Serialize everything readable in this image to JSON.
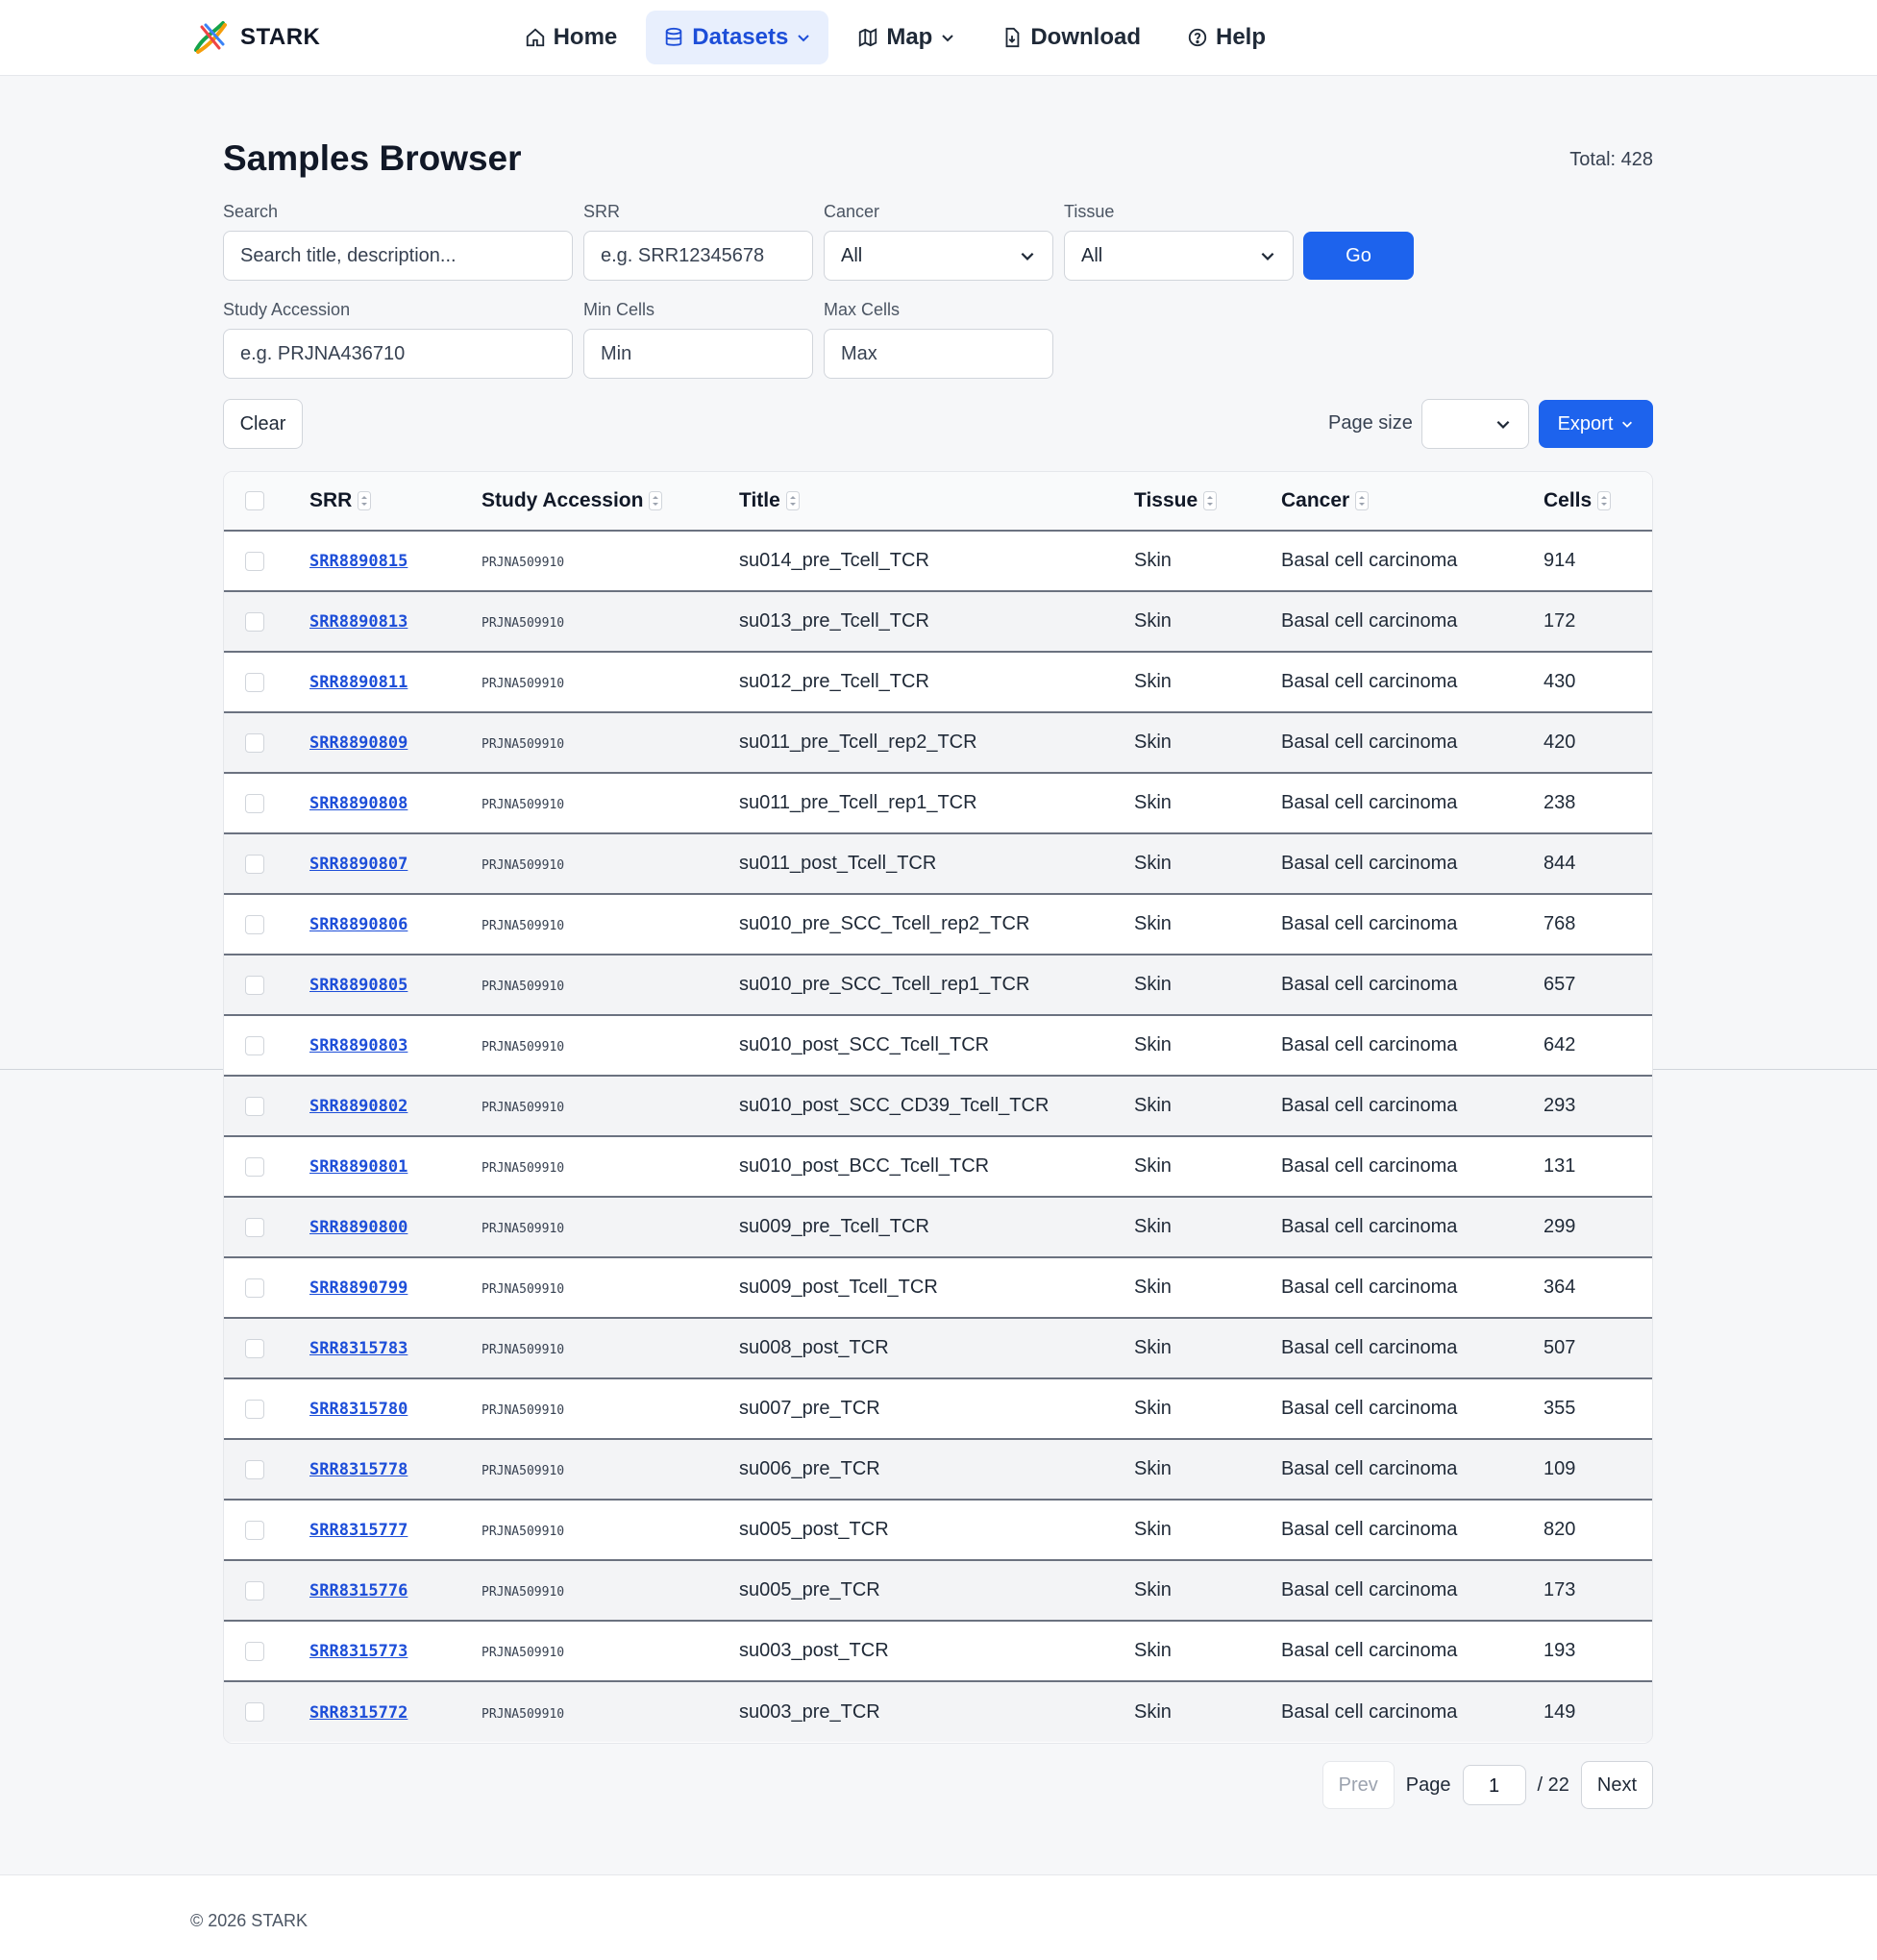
{
  "brand": {
    "name": "STARK"
  },
  "nav": {
    "home": "Home",
    "datasets": "Datasets",
    "map": "Map",
    "download": "Download",
    "help": "Help"
  },
  "page": {
    "title": "Samples Browser",
    "total": "Total: 428"
  },
  "filters": {
    "search_label": "Search",
    "search_placeholder": "Search title, description...",
    "srr_label": "SRR",
    "srr_placeholder": "e.g. SRR12345678",
    "cancer_label": "Cancer",
    "cancer_value": "All",
    "tissue_label": "Tissue",
    "tissue_value": "All",
    "go": "Go",
    "study_label": "Study Accession",
    "study_placeholder": "e.g. PRJNA436710",
    "min_label": "Min Cells",
    "min_placeholder": "Min",
    "max_label": "Max Cells",
    "max_placeholder": "Max",
    "clear": "Clear",
    "page_size_label": "Page size",
    "export": "Export"
  },
  "table": {
    "columns": [
      "SRR",
      "Study Accession",
      "Title",
      "Tissue",
      "Cancer",
      "Cells"
    ],
    "rows": [
      {
        "srr": "SRR8890815",
        "acc": "PRJNA509910",
        "title": "su014_pre_Tcell_TCR",
        "tissue": "Skin",
        "cancer": "Basal cell carcinoma",
        "cells": "914"
      },
      {
        "srr": "SRR8890813",
        "acc": "PRJNA509910",
        "title": "su013_pre_Tcell_TCR",
        "tissue": "Skin",
        "cancer": "Basal cell carcinoma",
        "cells": "172"
      },
      {
        "srr": "SRR8890811",
        "acc": "PRJNA509910",
        "title": "su012_pre_Tcell_TCR",
        "tissue": "Skin",
        "cancer": "Basal cell carcinoma",
        "cells": "430"
      },
      {
        "srr": "SRR8890809",
        "acc": "PRJNA509910",
        "title": "su011_pre_Tcell_rep2_TCR",
        "tissue": "Skin",
        "cancer": "Basal cell carcinoma",
        "cells": "420"
      },
      {
        "srr": "SRR8890808",
        "acc": "PRJNA509910",
        "title": "su011_pre_Tcell_rep1_TCR",
        "tissue": "Skin",
        "cancer": "Basal cell carcinoma",
        "cells": "238"
      },
      {
        "srr": "SRR8890807",
        "acc": "PRJNA509910",
        "title": "su011_post_Tcell_TCR",
        "tissue": "Skin",
        "cancer": "Basal cell carcinoma",
        "cells": "844"
      },
      {
        "srr": "SRR8890806",
        "acc": "PRJNA509910",
        "title": "su010_pre_SCC_Tcell_rep2_TCR",
        "tissue": "Skin",
        "cancer": "Basal cell carcinoma",
        "cells": "768"
      },
      {
        "srr": "SRR8890805",
        "acc": "PRJNA509910",
        "title": "su010_pre_SCC_Tcell_rep1_TCR",
        "tissue": "Skin",
        "cancer": "Basal cell carcinoma",
        "cells": "657"
      },
      {
        "srr": "SRR8890803",
        "acc": "PRJNA509910",
        "title": "su010_post_SCC_Tcell_TCR",
        "tissue": "Skin",
        "cancer": "Basal cell carcinoma",
        "cells": "642"
      },
      {
        "srr": "SRR8890802",
        "acc": "PRJNA509910",
        "title": "su010_post_SCC_CD39_Tcell_TCR",
        "tissue": "Skin",
        "cancer": "Basal cell carcinoma",
        "cells": "293"
      },
      {
        "srr": "SRR8890801",
        "acc": "PRJNA509910",
        "title": "su010_post_BCC_Tcell_TCR",
        "tissue": "Skin",
        "cancer": "Basal cell carcinoma",
        "cells": "131"
      },
      {
        "srr": "SRR8890800",
        "acc": "PRJNA509910",
        "title": "su009_pre_Tcell_TCR",
        "tissue": "Skin",
        "cancer": "Basal cell carcinoma",
        "cells": "299"
      },
      {
        "srr": "SRR8890799",
        "acc": "PRJNA509910",
        "title": "su009_post_Tcell_TCR",
        "tissue": "Skin",
        "cancer": "Basal cell carcinoma",
        "cells": "364"
      },
      {
        "srr": "SRR8315783",
        "acc": "PRJNA509910",
        "title": "su008_post_TCR",
        "tissue": "Skin",
        "cancer": "Basal cell carcinoma",
        "cells": "507"
      },
      {
        "srr": "SRR8315780",
        "acc": "PRJNA509910",
        "title": "su007_pre_TCR",
        "tissue": "Skin",
        "cancer": "Basal cell carcinoma",
        "cells": "355"
      },
      {
        "srr": "SRR8315778",
        "acc": "PRJNA509910",
        "title": "su006_pre_TCR",
        "tissue": "Skin",
        "cancer": "Basal cell carcinoma",
        "cells": "109"
      },
      {
        "srr": "SRR8315777",
        "acc": "PRJNA509910",
        "title": "su005_post_TCR",
        "tissue": "Skin",
        "cancer": "Basal cell carcinoma",
        "cells": "820"
      },
      {
        "srr": "SRR8315776",
        "acc": "PRJNA509910",
        "title": "su005_pre_TCR",
        "tissue": "Skin",
        "cancer": "Basal cell carcinoma",
        "cells": "173"
      },
      {
        "srr": "SRR8315773",
        "acc": "PRJNA509910",
        "title": "su003_post_TCR",
        "tissue": "Skin",
        "cancer": "Basal cell carcinoma",
        "cells": "193"
      },
      {
        "srr": "SRR8315772",
        "acc": "PRJNA509910",
        "title": "su003_pre_TCR",
        "tissue": "Skin",
        "cancer": "Basal cell carcinoma",
        "cells": "149"
      }
    ]
  },
  "pager": {
    "prev": "Prev",
    "page_label": "Page",
    "current": "1",
    "of": "/ 22",
    "next": "Next"
  },
  "footer": {
    "text": "© 2026 STARK"
  },
  "colors": {
    "accent": "#1d63ed",
    "link": "#1d4ed8"
  }
}
